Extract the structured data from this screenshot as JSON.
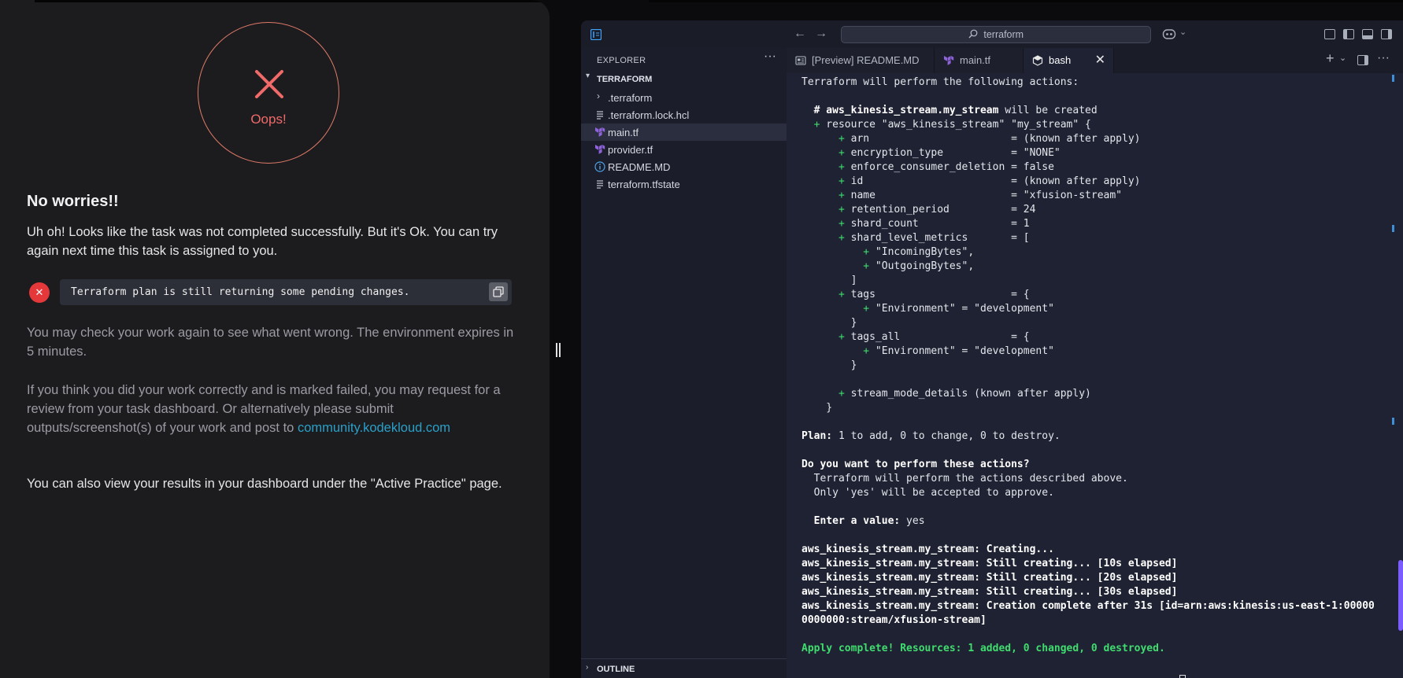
{
  "result": {
    "oops_label": "Oops!",
    "heading": "No worries!!",
    "description": "Uh oh! Looks like the task was not completed successfully. But it's Ok. You can try again next time this task is assigned to you.",
    "error_message": "Terraform plan is still returning some pending changes.",
    "info_text_1": "You may check your work again to see what went wrong. The environment expires in 5 minutes.",
    "info_text_2": "If you think you did your work correctly and is marked failed, you may request for a review from your task dashboard. Or alternatively please submit outputs/screenshot(s) of your work and post to",
    "info_link": "community.kodekloud.com",
    "final_text": "You can also view your results in your dashboard under the \"Active Practice\" page.",
    "colors": {
      "error": "#e5383b",
      "oops": "#f06a6a",
      "link": "#2aa0c8"
    }
  },
  "vscode": {
    "search_placeholder": "terraform",
    "explorer": {
      "title": "EXPLORER",
      "more": "···",
      "folder": "TERRAFORM",
      "items": [
        {
          "label": ".terraform",
          "icon": "chevron-right-icon"
        },
        {
          "label": ".terraform.lock.hcl",
          "icon": "lines-file-icon"
        },
        {
          "label": "main.tf",
          "icon": "terraform-icon"
        },
        {
          "label": "provider.tf",
          "icon": "terraform-icon"
        },
        {
          "label": "README.MD",
          "icon": "info-icon"
        },
        {
          "label": "terraform.tfstate",
          "icon": "lines-file-icon"
        }
      ],
      "outline": "OUTLINE"
    },
    "tabs": [
      {
        "label": "[Preview] README.MD",
        "icon": "preview-icon"
      },
      {
        "label": "main.tf",
        "icon": "terraform-icon"
      },
      {
        "label": "bash",
        "icon": "terminal-icon"
      }
    ],
    "tab_actions": {
      "new": "+",
      "new_menu": "⌄",
      "more": "···"
    },
    "colors": {
      "terraform": "#8e63d9",
      "terminal_green": "#3fdc6e",
      "accent": "#7b5cff"
    }
  },
  "terminal": {
    "lines": [
      [
        {
          "t": "Terraform will perform the following actions:"
        }
      ],
      [
        {
          "t": ""
        }
      ],
      [
        {
          "t": "  "
        },
        {
          "t": "# aws_kinesis_stream.my_stream",
          "s": "bold"
        },
        {
          "t": " will be created"
        }
      ],
      [
        {
          "t": "  "
        },
        {
          "t": "+",
          "s": "green"
        },
        {
          "t": " resource \"aws_kinesis_stream\" \"my_stream\" {"
        }
      ],
      [
        {
          "t": "      "
        },
        {
          "t": "+",
          "s": "green"
        },
        {
          "t": " arn                       = (known after apply)"
        }
      ],
      [
        {
          "t": "      "
        },
        {
          "t": "+",
          "s": "green"
        },
        {
          "t": " encryption_type           = \"NONE\""
        }
      ],
      [
        {
          "t": "      "
        },
        {
          "t": "+",
          "s": "green"
        },
        {
          "t": " enforce_consumer_deletion = false"
        }
      ],
      [
        {
          "t": "      "
        },
        {
          "t": "+",
          "s": "green"
        },
        {
          "t": " id                        = (known after apply)"
        }
      ],
      [
        {
          "t": "      "
        },
        {
          "t": "+",
          "s": "green"
        },
        {
          "t": " name                      = \"xfusion-stream\""
        }
      ],
      [
        {
          "t": "      "
        },
        {
          "t": "+",
          "s": "green"
        },
        {
          "t": " retention_period          = 24"
        }
      ],
      [
        {
          "t": "      "
        },
        {
          "t": "+",
          "s": "green"
        },
        {
          "t": " shard_count               = 1"
        }
      ],
      [
        {
          "t": "      "
        },
        {
          "t": "+",
          "s": "green"
        },
        {
          "t": " shard_level_metrics       = ["
        }
      ],
      [
        {
          "t": "          "
        },
        {
          "t": "+",
          "s": "green"
        },
        {
          "t": " \"IncomingBytes\","
        }
      ],
      [
        {
          "t": "          "
        },
        {
          "t": "+",
          "s": "green"
        },
        {
          "t": " \"OutgoingBytes\","
        }
      ],
      [
        {
          "t": "        ]"
        }
      ],
      [
        {
          "t": "      "
        },
        {
          "t": "+",
          "s": "green"
        },
        {
          "t": " tags                      = {"
        }
      ],
      [
        {
          "t": "          "
        },
        {
          "t": "+",
          "s": "green"
        },
        {
          "t": " \"Environment\" = \"development\""
        }
      ],
      [
        {
          "t": "        }"
        }
      ],
      [
        {
          "t": "      "
        },
        {
          "t": "+",
          "s": "green"
        },
        {
          "t": " tags_all                  = {"
        }
      ],
      [
        {
          "t": "          "
        },
        {
          "t": "+",
          "s": "green"
        },
        {
          "t": " \"Environment\" = \"development\""
        }
      ],
      [
        {
          "t": "        }"
        }
      ],
      [
        {
          "t": ""
        }
      ],
      [
        {
          "t": "      "
        },
        {
          "t": "+",
          "s": "green"
        },
        {
          "t": " stream_mode_details (known after apply)"
        }
      ],
      [
        {
          "t": "    }"
        }
      ],
      [
        {
          "t": ""
        }
      ],
      [
        {
          "t": "Plan:",
          "s": "bold"
        },
        {
          "t": " 1 to add, 0 to change, 0 to destroy."
        }
      ],
      [
        {
          "t": ""
        }
      ],
      [
        {
          "t": "Do you want to perform these actions?",
          "s": "bold"
        }
      ],
      [
        {
          "t": "  Terraform will perform the actions described above."
        }
      ],
      [
        {
          "t": "  Only 'yes' will be accepted to approve."
        }
      ],
      [
        {
          "t": ""
        }
      ],
      [
        {
          "t": "  "
        },
        {
          "t": "Enter a value:",
          "s": "bold"
        },
        {
          "t": " yes"
        }
      ],
      [
        {
          "t": ""
        }
      ],
      [
        {
          "t": "aws_kinesis_stream.my_stream: Creating...",
          "s": "bold"
        }
      ],
      [
        {
          "t": "aws_kinesis_stream.my_stream: Still creating... [10s elapsed]",
          "s": "bold"
        }
      ],
      [
        {
          "t": "aws_kinesis_stream.my_stream: Still creating... [20s elapsed]",
          "s": "bold"
        }
      ],
      [
        {
          "t": "aws_kinesis_stream.my_stream: Still creating... [30s elapsed]",
          "s": "bold"
        }
      ],
      [
        {
          "t": "aws_kinesis_stream.my_stream: Creation complete after 31s [id=arn:aws:kinesis:us-east-1:00000",
          "s": "bold"
        }
      ],
      [
        {
          "t": "0000000:stream/xfusion-stream]",
          "s": "bold"
        }
      ],
      [
        {
          "t": ""
        }
      ],
      [
        {
          "t": "Apply complete! Resources: 1 added, 0 changed, 0 destroyed.",
          "s": "green-bold"
        }
      ]
    ]
  }
}
